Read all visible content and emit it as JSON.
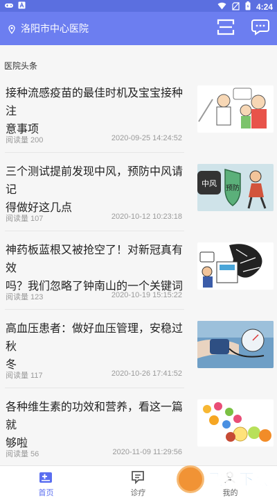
{
  "status_bar": {
    "time": "4:24",
    "left_icons": [
      "gamepad-icon",
      "a-icon"
    ],
    "right_icons": [
      "wifi-icon",
      "no-sim-icon",
      "battery-icon"
    ]
  },
  "app_bar": {
    "location": "洛阳市中心医院",
    "actions": [
      "scan-icon",
      "chat-icon"
    ],
    "colors": {
      "bar": "#6c7ef0",
      "status": "#5b6fe0"
    }
  },
  "section_title": "医院头条",
  "news": [
    {
      "title_line1": "接种流感疫苗的最佳时机及宝宝接种注",
      "title_line2": "意事项",
      "reads": "阅读量 200",
      "date": "2020-09-25 14:24:52"
    },
    {
      "title_line1": "三个测试提前发现中风，预防中风请记",
      "title_line2": "得做好这几点",
      "reads": "阅读量 107",
      "date": "2020-10-12 10:23:18"
    },
    {
      "title_line1": "神药板蓝根又被抢空了！对新冠真有效",
      "title_line2": "吗？我们忽略了钟南山的一个关键词",
      "reads": "阅读量 123",
      "date": "2020-10-19 15:15:22"
    },
    {
      "title_line1": "高血压患者：做好血压管理，安稳过秋",
      "title_line2": "冬",
      "reads": "阅读量 117",
      "date": "2020-10-26 17:41:52"
    },
    {
      "title_line1": "各种维生素的功效和营养，看这一篇就",
      "title_line2": "够啦",
      "reads": "阅读量 56",
      "date": "2020-11-09 11:29:56"
    }
  ],
  "thumb_text": {
    "stroke": "中风",
    "prevent": "预防"
  },
  "tabs": [
    {
      "label": "首页",
      "icon": "home-icon",
      "active": true
    },
    {
      "label": "诊疗",
      "icon": "consult-icon",
      "active": false
    },
    {
      "label": "我的",
      "icon": "profile-icon",
      "active": false
    }
  ],
  "watermark_text": "飞翔下载",
  "accent_color": "#5a6ef0"
}
